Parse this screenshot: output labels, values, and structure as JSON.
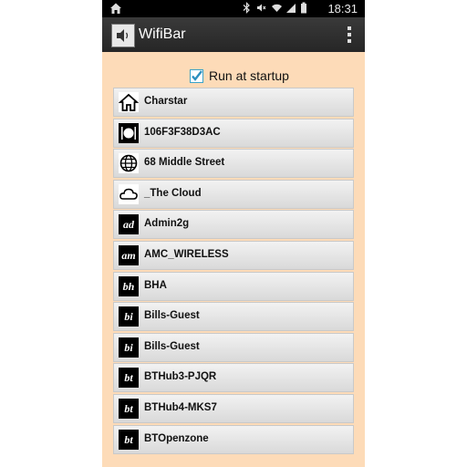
{
  "statusbar": {
    "time": "18:31",
    "icons": [
      "bluetooth-icon",
      "mute-icon",
      "wifi-icon",
      "signal-icon",
      "battery-icon"
    ]
  },
  "app": {
    "title": "WifiBar"
  },
  "startup": {
    "label": "Run at startup",
    "checked": true
  },
  "networks": [
    {
      "name": "Charstar",
      "icon": "home-icon",
      "abbr": ""
    },
    {
      "name": "106F3F38D3AC",
      "icon": "restaurant-icon",
      "abbr": ""
    },
    {
      "name": "68 Middle Street",
      "icon": "globe-icon",
      "abbr": ""
    },
    {
      "name": "_The Cloud",
      "icon": "cloud-icon",
      "abbr": ""
    },
    {
      "name": "Admin2g",
      "icon": "text-icon",
      "abbr": "ad"
    },
    {
      "name": "AMC_WIRELESS",
      "icon": "text-icon",
      "abbr": "am"
    },
    {
      "name": "BHA",
      "icon": "text-icon",
      "abbr": "bh"
    },
    {
      "name": "Bills-Guest",
      "icon": "text-icon",
      "abbr": "bi"
    },
    {
      "name": "Bills-Guest",
      "icon": "text-icon",
      "abbr": "bi"
    },
    {
      "name": "BTHub3-PJQR",
      "icon": "text-icon",
      "abbr": "bt"
    },
    {
      "name": "BTHub4-MKS7",
      "icon": "text-icon",
      "abbr": "bt"
    },
    {
      "name": "BTOpenzone",
      "icon": "text-icon",
      "abbr": "bt"
    }
  ],
  "colors": {
    "background": "#fddbb8",
    "actionbar": "#2e2e2e",
    "accent": "#3aa2c8"
  }
}
